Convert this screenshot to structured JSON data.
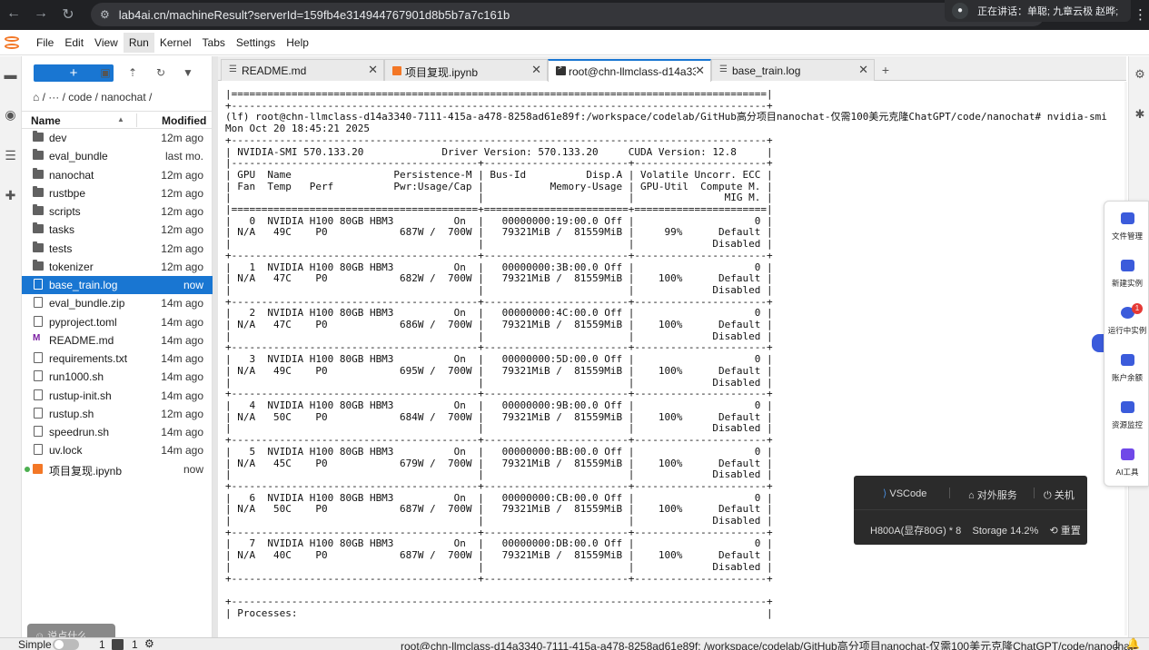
{
  "browser": {
    "url": "lab4ai.cn/machineResult?serverId=159fb4e314944767901d8b5b7a7c161b",
    "speaking": "正在讲话：单聪; 九章云极 赵晔;"
  },
  "menubar": {
    "items": [
      "File",
      "Edit",
      "View",
      "Run",
      "Kernel",
      "Tabs",
      "Settings",
      "Help"
    ]
  },
  "filebrowser": {
    "new_label": "+",
    "breadcrumb": "/  ···  / code / nanochat /",
    "col_name": "Name",
    "col_modified": "Modified",
    "items": [
      {
        "name": "dev",
        "modified": "12m ago"
      },
      {
        "name": "eval_bundle",
        "modified": "last mo."
      },
      {
        "name": "nanochat",
        "modified": "12m ago"
      },
      {
        "name": "rustbpe",
        "modified": "12m ago"
      },
      {
        "name": "scripts",
        "modified": "12m ago"
      },
      {
        "name": "tasks",
        "modified": "12m ago"
      },
      {
        "name": "tests",
        "modified": "12m ago"
      },
      {
        "name": "tokenizer",
        "modified": "12m ago"
      },
      {
        "name": "base_train.log",
        "modified": "now"
      },
      {
        "name": "eval_bundle.zip",
        "modified": "14m ago"
      },
      {
        "name": "pyproject.toml",
        "modified": "14m ago"
      },
      {
        "name": "README.md",
        "modified": "14m ago"
      },
      {
        "name": "requirements.txt",
        "modified": "14m ago"
      },
      {
        "name": "run1000.sh",
        "modified": "14m ago"
      },
      {
        "name": "rustup-init.sh",
        "modified": "14m ago"
      },
      {
        "name": "rustup.sh",
        "modified": "12m ago"
      },
      {
        "name": "speedrun.sh",
        "modified": "14m ago"
      },
      {
        "name": "uv.lock",
        "modified": "14m ago"
      },
      {
        "name": "项目复现.ipynb",
        "modified": "now"
      }
    ],
    "chat_placeholder": "说点什么..."
  },
  "tabs": [
    {
      "label": "README.md"
    },
    {
      "label": "项目复现.ipynb"
    },
    {
      "label": "root@chn-llmclass-d14a33"
    },
    {
      "label": "base_train.log"
    }
  ],
  "terminal": {
    "text": "|=========================================================================================|\n+-----------------------------------------------------------------------------------------+\n(lf) root@chn-llmclass-d14a3340-7111-415a-a478-8258ad61e89f:/workspace/codelab/GitHub高分项目nanochat-仅需100美元克隆ChatGPT/code/nanochat# nvidia-smi\nMon Oct 20 18:45:21 2025\n+-----------------------------------------------------------------------------------------+\n| NVIDIA-SMI 570.133.20             Driver Version: 570.133.20     CUDA Version: 12.8     |\n|-----------------------------------------+------------------------+----------------------+\n| GPU  Name                 Persistence-M | Bus-Id          Disp.A | Volatile Uncorr. ECC |\n| Fan  Temp   Perf          Pwr:Usage/Cap |           Memory-Usage | GPU-Util  Compute M. |\n|                                         |                        |               MIG M. |\n|=========================================+========================+======================|\n|   0  NVIDIA H100 80GB HBM3          On  |   00000000:19:00.0 Off |                    0 |\n| N/A   49C    P0            687W /  700W |   79321MiB /  81559MiB |     99%      Default |\n|                                         |                        |             Disabled |\n+-----------------------------------------+------------------------+----------------------+\n|   1  NVIDIA H100 80GB HBM3          On  |   00000000:3B:00.0 Off |                    0 |\n| N/A   47C    P0            682W /  700W |   79321MiB /  81559MiB |    100%      Default |\n|                                         |                        |             Disabled |\n+-----------------------------------------+------------------------+----------------------+\n|   2  NVIDIA H100 80GB HBM3          On  |   00000000:4C:00.0 Off |                    0 |\n| N/A   47C    P0            686W /  700W |   79321MiB /  81559MiB |    100%      Default |\n|                                         |                        |             Disabled |\n+-----------------------------------------+------------------------+----------------------+\n|   3  NVIDIA H100 80GB HBM3          On  |   00000000:5D:00.0 Off |                    0 |\n| N/A   49C    P0            695W /  700W |   79321MiB /  81559MiB |    100%      Default |\n|                                         |                        |             Disabled |\n+-----------------------------------------+------------------------+----------------------+\n|   4  NVIDIA H100 80GB HBM3          On  |   00000000:9B:00.0 Off |                    0 |\n| N/A   50C    P0            684W /  700W |   79321MiB /  81559MiB |    100%      Default |\n|                                         |                        |             Disabled |\n+-----------------------------------------+------------------------+----------------------+\n|   5  NVIDIA H100 80GB HBM3          On  |   00000000:BB:00.0 Off |                    0 |\n| N/A   45C    P0            679W /  700W |   79321MiB /  81559MiB |    100%      Default |\n|                                         |                        |             Disabled |\n+-----------------------------------------+------------------------+----------------------+\n|   6  NVIDIA H100 80GB HBM3          On  |   00000000:CB:00.0 Off |                    0 |\n| N/A   50C    P0            687W /  700W |   79321MiB /  81559MiB |    100%      Default |\n|                                         |                        |             Disabled |\n+-----------------------------------------+------------------------+----------------------+\n|   7  NVIDIA H100 80GB HBM3          On  |   00000000:DB:00.0 Off |                    0 |\n| N/A   40C    P0            687W /  700W |   79321MiB /  81559MiB |    100%      Default |\n|                                         |                        |             Disabled |\n+-----------------------------------------+------------------------+----------------------+\n\n+-----------------------------------------------------------------------------------------+\n| Processes:                                                                              |"
  },
  "floating_toolbar": [
    {
      "label": "文件管理",
      "icon": "folder-icon"
    },
    {
      "label": "新建实例",
      "icon": "plus-square-icon"
    },
    {
      "label": "运行中实例",
      "icon": "running-icon",
      "badge": "1"
    },
    {
      "label": "账户余额",
      "icon": "wallet-icon"
    },
    {
      "label": "资源监控",
      "icon": "chip-icon"
    },
    {
      "label": "AI工具",
      "icon": "ai-icon"
    }
  ],
  "machine_panel": {
    "vscode": "VSCode",
    "service": "对外服务",
    "shutdown": "关机",
    "spec": "H800A(显存80G) * 8",
    "storage": "Storage 14.2%",
    "reset": "重置"
  },
  "statusbar": {
    "mode": "Simple",
    "terminals": "1",
    "kernels": "1",
    "path": "root@chn-llmclass-d14a3340-7111-415a-a478-8258ad61e89f: /workspace/codelab/GitHub高分项目nanochat-仅需100美元克隆ChatGPT/code/nanochat",
    "notifications": "1"
  },
  "colors": {
    "accent": "#1976d2",
    "notebook": "#f37726",
    "platform": "#3b5bdb"
  }
}
